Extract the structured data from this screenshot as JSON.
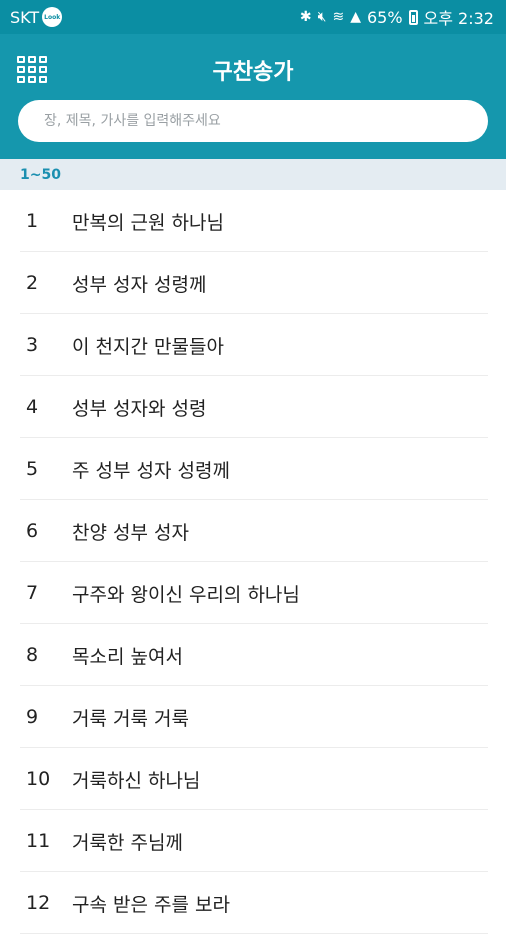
{
  "status_bar": {
    "carrier": "SKT",
    "carrier_logo": "Look",
    "battery_percent": "65%",
    "time": "오후 2:32",
    "icons": [
      "bluetooth-icon",
      "mute-icon",
      "wifi-icon",
      "signal-icon",
      "battery-icon"
    ]
  },
  "header": {
    "title": "구찬송가",
    "search_placeholder": "장, 제목, 가사를 입력해주세요",
    "search_value": ""
  },
  "section": {
    "label": "1~50"
  },
  "hymns": [
    {
      "num": "1",
      "title": "만복의 근원 하나님"
    },
    {
      "num": "2",
      "title": "성부 성자 성령께"
    },
    {
      "num": "3",
      "title": "이 천지간 만물들아"
    },
    {
      "num": "4",
      "title": "성부 성자와 성령"
    },
    {
      "num": "5",
      "title": "주 성부 성자 성령께"
    },
    {
      "num": "6",
      "title": "찬양 성부 성자"
    },
    {
      "num": "7",
      "title": "구주와 왕이신 우리의 하나님"
    },
    {
      "num": "8",
      "title": "목소리 높여서"
    },
    {
      "num": "9",
      "title": "거룩 거룩 거룩"
    },
    {
      "num": "10",
      "title": "거룩하신 하나님"
    },
    {
      "num": "11",
      "title": "거룩한 주님께"
    },
    {
      "num": "12",
      "title": "구속 받은 주를 보라"
    }
  ],
  "colors": {
    "header_bg": "#1597ad",
    "status_bg": "#0b8ea3",
    "section_bg": "#e4ecf2",
    "section_text": "#1b8fb0"
  }
}
